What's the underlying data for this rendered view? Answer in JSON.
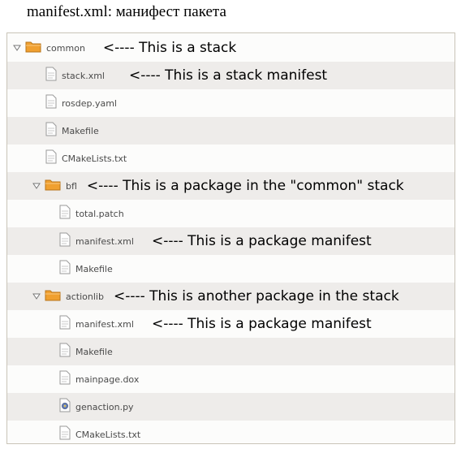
{
  "caption": "manifest.xml: манифест пакета",
  "tree": {
    "rows": [
      {
        "kind": "folder",
        "label": "common",
        "annotation": "<---- This is a stack"
      },
      {
        "kind": "file",
        "label": "stack.xml",
        "annotation": "<---- This is a stack manifest"
      },
      {
        "kind": "file",
        "label": "rosdep.yaml",
        "annotation": ""
      },
      {
        "kind": "file",
        "label": "Makefile",
        "annotation": ""
      },
      {
        "kind": "file",
        "label": "CMakeLists.txt",
        "annotation": ""
      },
      {
        "kind": "folder",
        "label": "bfl",
        "annotation": "<---- This is a package in the \"common\" stack"
      },
      {
        "kind": "file",
        "label": "total.patch",
        "annotation": ""
      },
      {
        "kind": "file",
        "label": "manifest.xml",
        "annotation": "<---- This is a package manifest"
      },
      {
        "kind": "file",
        "label": "Makefile",
        "annotation": ""
      },
      {
        "kind": "folder",
        "label": "actionlib",
        "annotation": "<---- This is another package in the stack"
      },
      {
        "kind": "file",
        "label": "manifest.xml",
        "annotation": "<---- This is a package manifest"
      },
      {
        "kind": "file",
        "label": "Makefile",
        "annotation": ""
      },
      {
        "kind": "file",
        "label": "mainpage.dox",
        "annotation": ""
      },
      {
        "kind": "script",
        "label": "genaction.py",
        "annotation": ""
      },
      {
        "kind": "file",
        "label": "CMakeLists.txt",
        "annotation": ""
      }
    ]
  },
  "icons": {
    "folder": "folder-icon",
    "file": "document-icon",
    "script": "python-script-icon",
    "expander": "expanded-triangle-icon"
  },
  "colors": {
    "folder_fill": "#f0a030",
    "row_alt": "#eeecea",
    "border": "#c9c4b8"
  }
}
